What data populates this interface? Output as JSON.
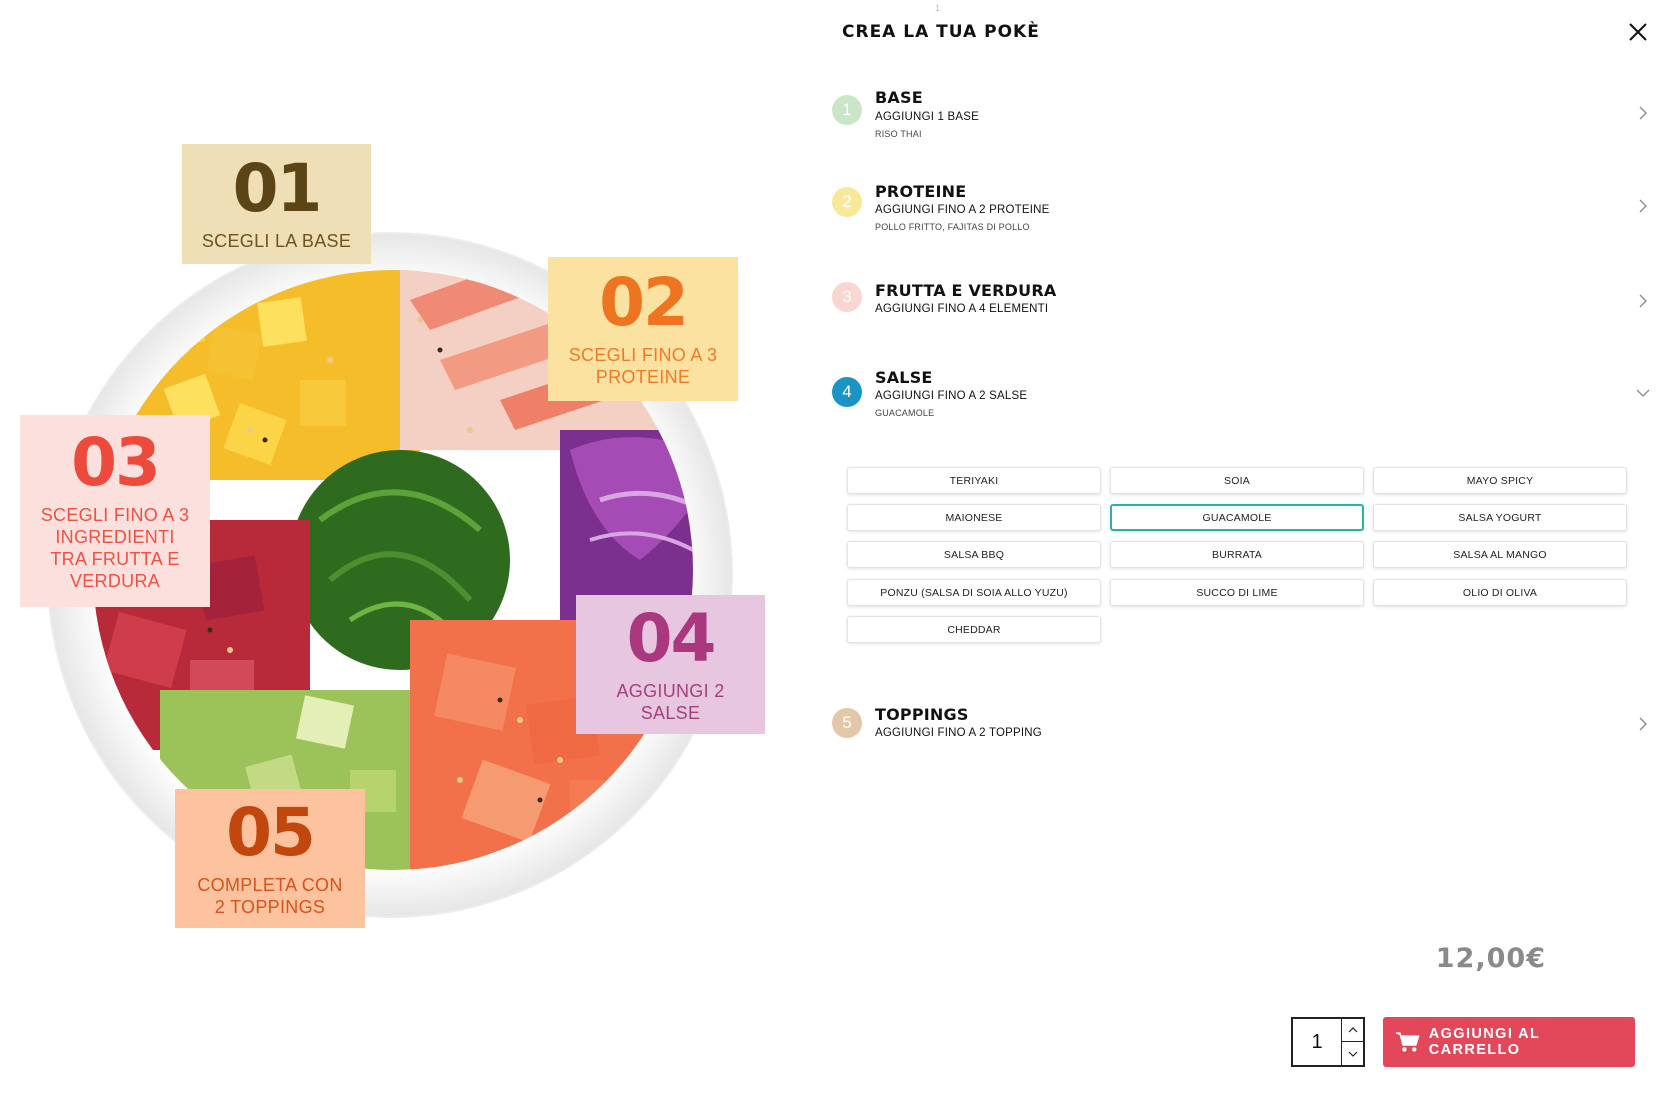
{
  "illustration": {
    "cards": [
      {
        "num": "01",
        "text": "SCEGLI LA BASE",
        "bg": "#efdfb6",
        "num_color": "#5b4516",
        "text_color": "#6e5320"
      },
      {
        "num": "02",
        "text": "SCEGLI FINO A 3 PROTEINE",
        "bg": "#fce2a0",
        "num_color": "#ef7422",
        "text_color": "#ef7a2a"
      },
      {
        "num": "03",
        "text": "SCEGLI FINO A 3 INGREDIENTI TRA FRUTTA E VERDURA",
        "bg": "#fce0dd",
        "num_color": "#ee4a3c",
        "text_color": "#ee5242"
      },
      {
        "num": "04",
        "text": "AGGIUNGI 2 SALSE",
        "bg": "#e7c6df",
        "num_color": "#a9387f",
        "text_color": "#a5407e"
      },
      {
        "num": "05",
        "text": "COMPLETA CON 2 TOPPINGS",
        "bg": "#fdc39e",
        "num_color": "#c1470f",
        "text_color": "#d3541c"
      }
    ]
  },
  "panel": {
    "top_tick": "1",
    "title": "CREA LA TUA POKÈ",
    "close_icon": "close-icon",
    "steps": [
      {
        "badge": "1",
        "badge_color": "#c9e6c7",
        "name": "BASE",
        "sub": "AGGIUNGI 1 BASE",
        "selected": "RISO THAI",
        "icon": "chevron-right-icon"
      },
      {
        "badge": "2",
        "badge_color": "#f7e89a",
        "name": "PROTEINE",
        "sub": "AGGIUNGI FINO A 2 PROTEINE",
        "selected": "POLLO FRITTO, FAJITAS DI POLLO",
        "icon": "chevron-right-icon"
      },
      {
        "badge": "3",
        "badge_color": "#f8d6d2",
        "name": "FRUTTA E VERDURA",
        "sub": "AGGIUNGI FINO A 4 ELEMENTI",
        "selected": "",
        "icon": "chevron-right-icon"
      },
      {
        "badge": "4",
        "badge_color": "#1b93c4",
        "name": "SALSE",
        "sub": "AGGIUNGI FINO A 2 SALSE",
        "selected": "GUACAMOLE",
        "icon": "chevron-down-icon"
      },
      {
        "badge": "5",
        "badge_color": "#e2c7a8",
        "name": "TOPPINGS",
        "sub": "AGGIUNGI FINO A 2 TOPPING",
        "selected": "",
        "icon": "chevron-right-icon"
      }
    ],
    "sauces": [
      {
        "label": "TERIYAKI",
        "selected": false
      },
      {
        "label": "SOIA",
        "selected": false
      },
      {
        "label": "MAYO SPICY",
        "selected": false
      },
      {
        "label": "MAIONESE",
        "selected": false
      },
      {
        "label": "GUACAMOLE",
        "selected": true
      },
      {
        "label": "SALSA YOGURT",
        "selected": false
      },
      {
        "label": "SALSA BBQ",
        "selected": false
      },
      {
        "label": "BURRATA",
        "selected": false
      },
      {
        "label": "SALSA AL MANGO",
        "selected": false
      },
      {
        "label": "PONZU (SALSA DI SOIA ALLO YUZU)",
        "selected": false
      },
      {
        "label": "SUCCO DI LIME",
        "selected": false
      },
      {
        "label": "OLIO DI OLIVA",
        "selected": false
      },
      {
        "label": "CHEDDAR",
        "selected": false
      }
    ],
    "price": "12,00€",
    "quantity": "1",
    "cart_button": "AGGIUNGI AL CARRELLO",
    "cart_icon": "cart-icon",
    "accent": "#e3475a",
    "selected_border": "#2cb1a8"
  }
}
